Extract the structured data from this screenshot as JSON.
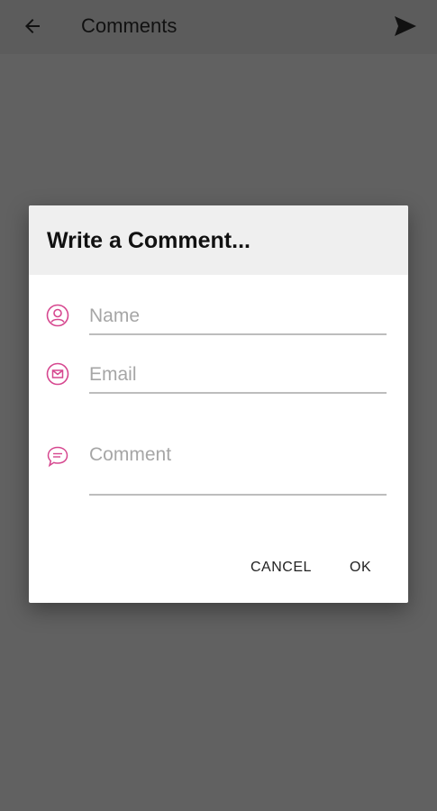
{
  "app_bar": {
    "title": "Comments",
    "back_icon": "arrow-left-icon",
    "send_icon": "send-icon"
  },
  "dialog": {
    "title": "Write a Comment...",
    "name_field": {
      "placeholder": "Name",
      "value": "",
      "icon": "user-circle-icon"
    },
    "email_field": {
      "placeholder": "Email",
      "value": "",
      "icon": "envelope-circle-icon"
    },
    "comment_field": {
      "placeholder": "Comment",
      "value": "",
      "icon": "chat-bubble-icon"
    },
    "cancel_label": "CANCEL",
    "ok_label": "OK"
  },
  "colors": {
    "scrim": "#616161",
    "accent_icon": "#d6478f",
    "dialog_header": "#efefef",
    "underline": "#bdbdbd"
  }
}
